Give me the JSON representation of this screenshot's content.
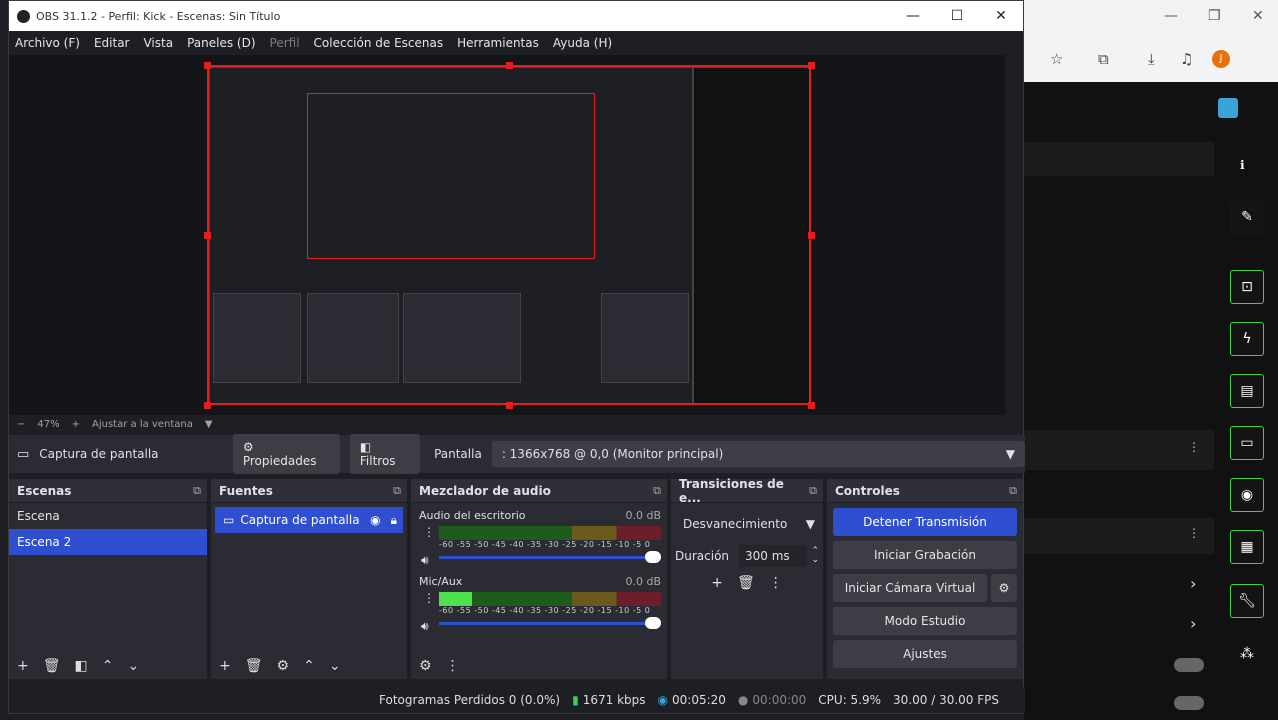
{
  "window": {
    "title": "OBS 31.1.2 - Perfil: Kick - Escenas: Sin Título",
    "minimize": "—",
    "maximize": "☐",
    "close": "✕"
  },
  "menu": [
    {
      "label": "Archivo (F)"
    },
    {
      "label": "Editar"
    },
    {
      "label": "Vista"
    },
    {
      "label": "Paneles (D)"
    },
    {
      "label": "Perfil"
    },
    {
      "label": "Colección de Escenas"
    },
    {
      "label": "Herramientas"
    },
    {
      "label": "Ayuda (H)"
    }
  ],
  "zoom": {
    "minus": "−",
    "value": "47%",
    "plus": "+",
    "fit": "Ajustar a la ventana",
    "arrow": "▼"
  },
  "source_bar": {
    "name": "Captura de pantalla",
    "properties": "Propiedades",
    "filters": "Filtros",
    "screen_label": "Pantalla",
    "screen_value": ": 1366x768 @ 0,0 (Monitor principal)"
  },
  "scenes": {
    "title": "Escenas",
    "items": [
      "Escena",
      "Escena 2"
    ],
    "selected": 1
  },
  "sources": {
    "title": "Fuentes",
    "items": [
      "Captura de pantalla"
    ]
  },
  "mixer": {
    "title": "Mezclador de audio",
    "ticks": "-60 -55 -50 -45 -40 -35 -30 -25 -20 -15 -10 -5 0",
    "channels": [
      {
        "name": "Audio del escritorio",
        "db": "0.0 dB",
        "level": 0
      },
      {
        "name": "Mic/Aux",
        "db": "0.0 dB",
        "level": 0.15
      }
    ]
  },
  "transitions": {
    "title": "Transiciones de e...",
    "selected": "Desvanecimiento",
    "duration_label": "Duración",
    "duration_value": "300 ms"
  },
  "controls": {
    "title": "Controles",
    "buttons": [
      "Detener Transmisión",
      "Iniciar Grabación",
      "Iniciar Cámara Virtual",
      "Modo Estudio",
      "Ajustes"
    ]
  },
  "status": {
    "dropped": "Fotogramas Perdidos 0 (0.0%)",
    "bitrate": "1671 kbps",
    "stream_time": "00:05:20",
    "rec_time": "00:00:00",
    "cpu": "CPU: 5.9%",
    "fps": "30.00 / 30.00 FPS"
  },
  "colors": {
    "accent": "#2f4fd0",
    "selection": "#e02020",
    "panel": "#2b2c33",
    "background": "#1e1f24",
    "side_button_border": "#3ad44a"
  },
  "icons": {
    "scene_add": "plus-icon",
    "scene_remove": "trash-icon",
    "source_settings": "gear-icon",
    "visibility": "eye-icon",
    "lock": "lock-icon",
    "volume": "speaker-icon"
  }
}
